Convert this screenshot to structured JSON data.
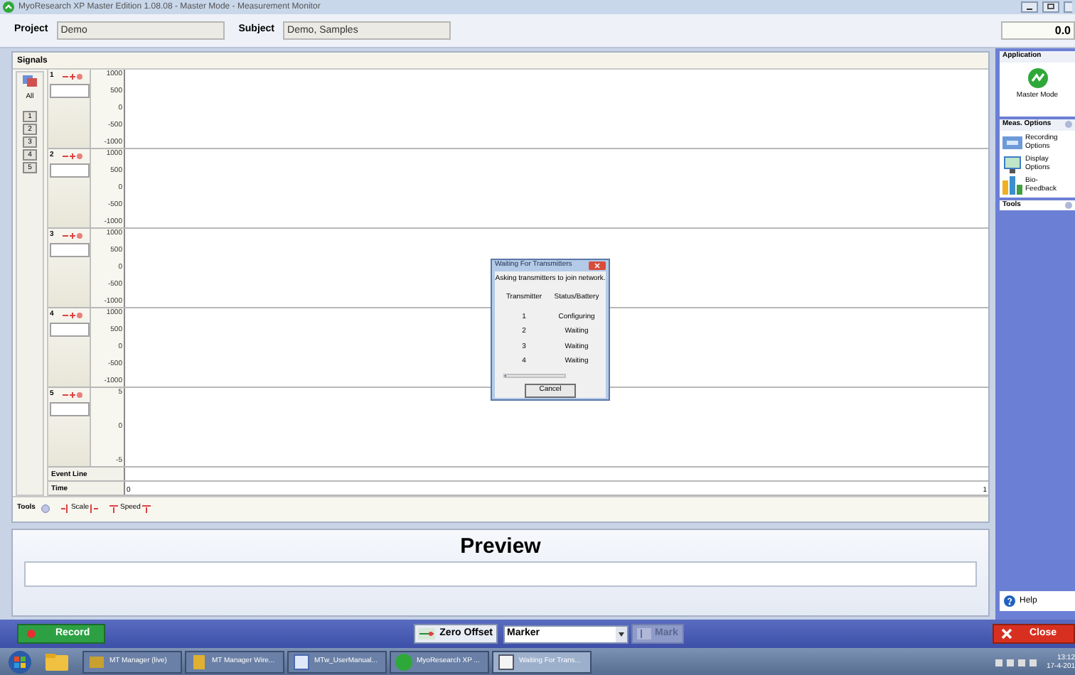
{
  "window": {
    "title": "MyoResearch XP Master Edition 1.08.08 - Master Mode - Measurement Monitor"
  },
  "header": {
    "project_label": "Project",
    "project": "Demo",
    "subject_label": "Subject",
    "subject": "Demo, Samples",
    "time": "0.0"
  },
  "signals": {
    "title": "Signals",
    "all_label": "All",
    "channel_buttons": [
      "1",
      "2",
      "3",
      "4",
      "5"
    ],
    "channels": [
      {
        "number": "1",
        "ticks": [
          "1000",
          "500",
          "0",
          "-500",
          "-1000"
        ]
      },
      {
        "number": "2",
        "ticks": [
          "1000",
          "500",
          "0",
          "-500",
          "-1000"
        ]
      },
      {
        "number": "3",
        "ticks": [
          "1000",
          "500",
          "0",
          "-500",
          "-1000"
        ]
      },
      {
        "number": "4",
        "ticks": [
          "1000",
          "500",
          "0",
          "-500",
          "-1000"
        ]
      },
      {
        "number": "5",
        "ticks": [
          "5",
          "0",
          "-5"
        ]
      }
    ],
    "event_line": "Event Line",
    "time_label": "Time",
    "time_start": "0",
    "time_end": "1"
  },
  "tools_bar": {
    "tools": "Tools",
    "scale": "Scale",
    "speed": "Speed"
  },
  "sidebar": {
    "application": {
      "title": "Application",
      "mode": "Master Mode"
    },
    "meas_options": {
      "title": "Meas. Options",
      "items": [
        {
          "label": "Recording Options",
          "kind": "recording"
        },
        {
          "label": "Display Options",
          "kind": "display"
        },
        {
          "label": "Bio-Feedback",
          "kind": "biofeedback"
        }
      ]
    },
    "tools": "Tools",
    "help": "Help"
  },
  "preview": {
    "title": "Preview"
  },
  "bottom_bar": {
    "record": "Record",
    "zero_offset": "Zero Offset",
    "marker": "Marker",
    "mark": "Mark",
    "mark_disabled": true,
    "close": "Close"
  },
  "dialog": {
    "title": "Waiting For Transmitters",
    "message": "Asking transmitters to join network.",
    "columns": [
      "Transmitter",
      "Status/Battery"
    ],
    "rows": [
      {
        "transmitter": "1",
        "status": "Configuring"
      },
      {
        "transmitter": "2",
        "status": "Waiting"
      },
      {
        "transmitter": "3",
        "status": "Waiting"
      },
      {
        "transmitter": "4",
        "status": "Waiting"
      }
    ],
    "progress": {
      "level": 0.03
    },
    "cancel": "Cancel"
  },
  "taskbar": {
    "items": [
      {
        "label": "MT Manager (live)",
        "active": false
      },
      {
        "label": "MT Manager Wire...",
        "active": false
      },
      {
        "label": "MTw_UserManual...",
        "active": false
      },
      {
        "label": "MyoResearch XP ...",
        "active": false
      },
      {
        "label": "Waiting For Trans...",
        "active": true
      }
    ],
    "clock": "13:12",
    "date": "17-4-201"
  }
}
